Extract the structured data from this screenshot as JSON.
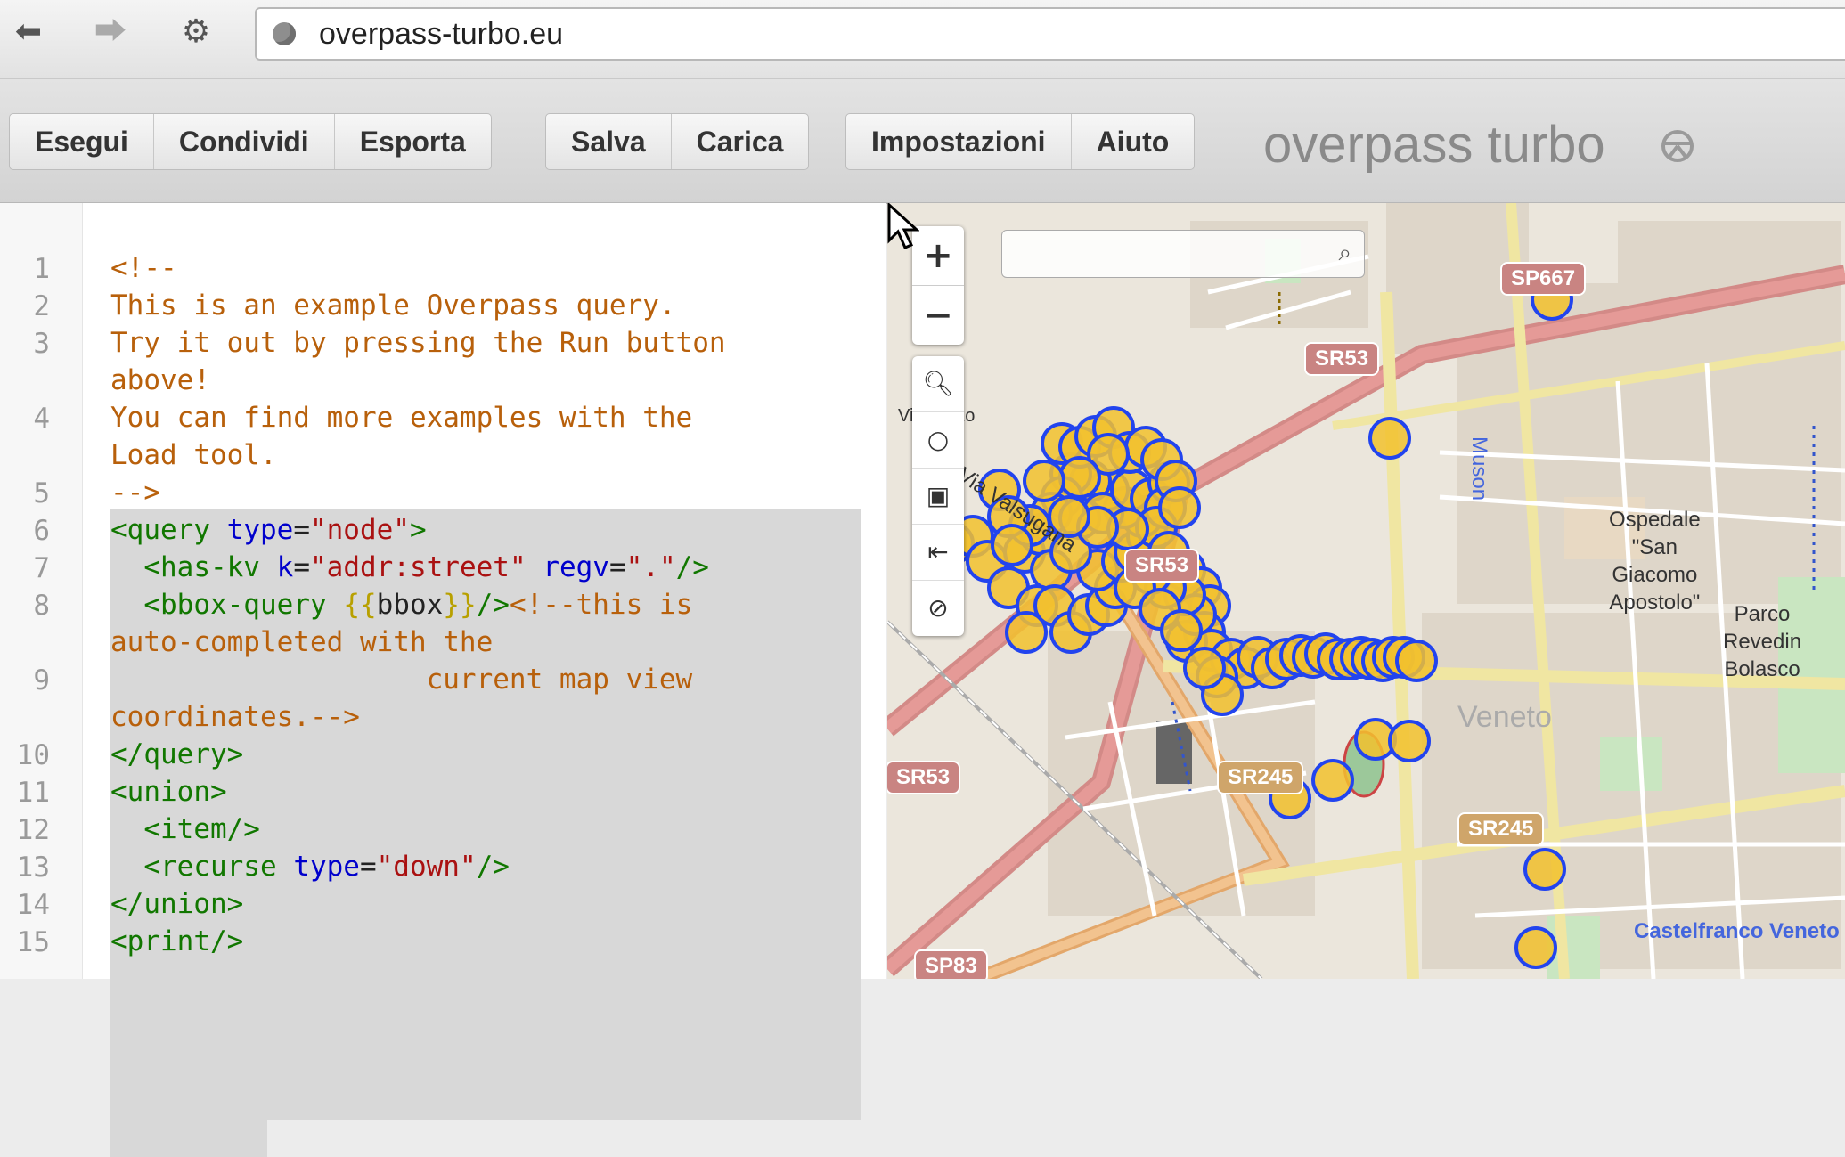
{
  "browser": {
    "url": "overpass-turbo.eu"
  },
  "toolbar": {
    "groups": [
      [
        "Esegui",
        "Condividi",
        "Esporta"
      ],
      [
        "Salva",
        "Carica"
      ],
      [
        "Impostazioni",
        "Aiuto"
      ]
    ],
    "brand": "overpass turbo"
  },
  "editor": {
    "line_numbers": [
      "1",
      "2",
      "3",
      "4",
      "5",
      "6",
      "7",
      "8",
      "9",
      "10",
      "11",
      "12",
      "13",
      "14",
      "15"
    ],
    "lines": {
      "l1": "<!--",
      "l2": "This is an example Overpass query.",
      "l3a": "Try it out by pressing the Run button",
      "l3b": "above!",
      "l4a": "You can find more examples with the",
      "l4b": "Load tool.",
      "l5": "-->",
      "l6_open": "<query",
      "l6_attr": "type",
      "l6_eq": "=",
      "l6_val": "\"node\"",
      "l6_close": ">",
      "l7_open": "  <has-kv",
      "l7_attr1": "k",
      "l7_val1": "\"addr:street\"",
      "l7_attr2": "regv",
      "l7_val2": "\".\"",
      "l7_close": "/>",
      "l8_open": "  <bbox-query",
      "l8_tpl1": "{{",
      "l8_bbox": "bbox",
      "l8_tpl2": "}}",
      "l8_close": "/>",
      "l8_comment": "<!--this is",
      "l8b": "auto-completed with the",
      "l9a": "                   current map view",
      "l9b": "coordinates.-->",
      "l10": "</query>",
      "l11": "<union>",
      "l12": "  <item/>",
      "l13_open": "  <recurse",
      "l13_attr": "type",
      "l13_val": "\"down\"",
      "l13_close": "/>",
      "l14": "</union>",
      "l15": "<print/>"
    }
  },
  "map": {
    "zoom_in": "+",
    "zoom_out": "−",
    "tools": [
      "search-icon",
      "circle-icon",
      "image-icon",
      "arrow-left-bar-icon",
      "cancel-icon"
    ],
    "roads": [
      "SP667",
      "SR53",
      "SR53",
      "SR53",
      "SR245",
      "SR245",
      "SP83"
    ],
    "labels": {
      "villarazzo": "Villarazzo",
      "valsugana": "Via Valsugana",
      "ospedale": "Ospedale\n\"San\nGiacomo\nApostolo\"",
      "parco": "Parco\nRevedin\nBolasco",
      "muson": "Muson",
      "veneto": "Veneto",
      "castelfranco": "Castelfranco Veneto"
    },
    "marker_color": "#f2c12e",
    "marker_stroke": "#2244ee"
  }
}
